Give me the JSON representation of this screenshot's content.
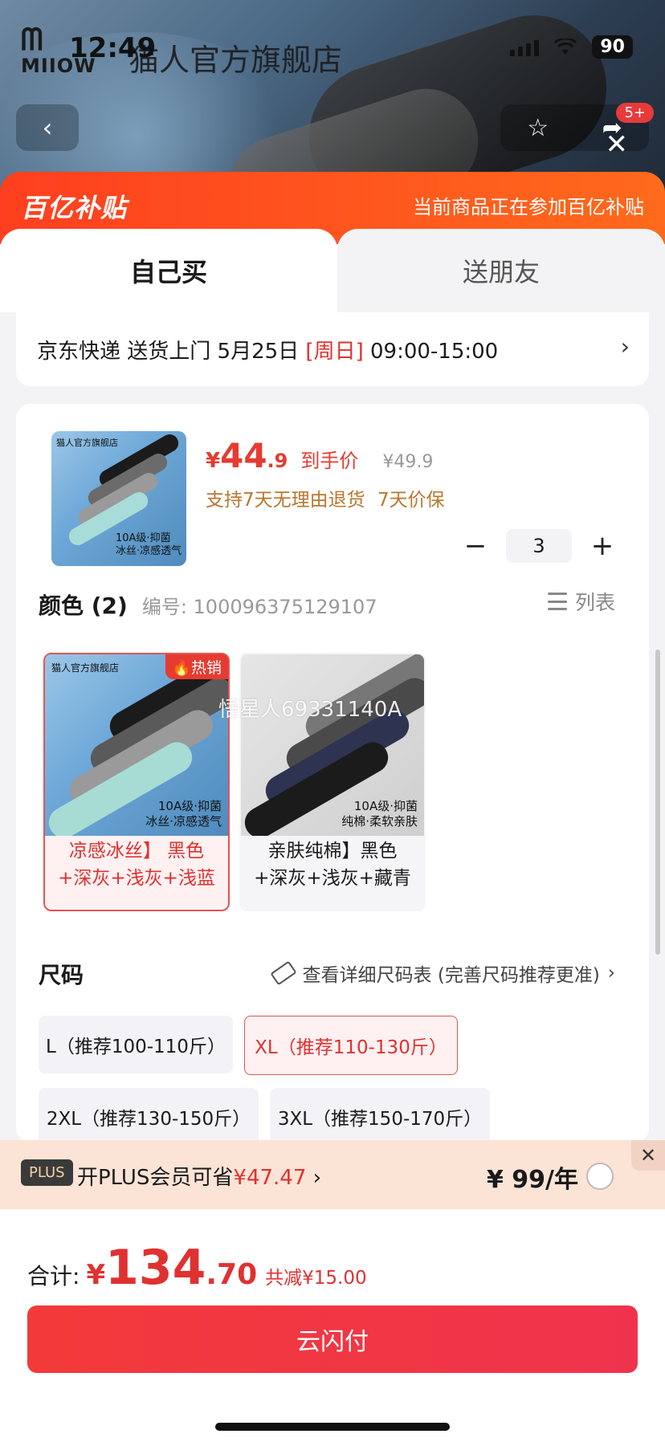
{
  "status_bar": {
    "time": "12:49",
    "battery": "90"
  },
  "header": {
    "brand_logo": "MIIOW",
    "store_name": "猫人官方旗舰店",
    "back_icon": "chevron-left-icon",
    "badge": "5+"
  },
  "subsidy": {
    "logo": "百亿补贴",
    "note": "当前商品正在参加百亿补贴"
  },
  "tabs": [
    {
      "label": "自己买"
    },
    {
      "label": "送朋友"
    }
  ],
  "delivery": {
    "prefix": "京东快递 送货上门 5月25日 ",
    "day": "[周日]",
    "time": " 09:00-15:00"
  },
  "product": {
    "thumb_brand": "猫人官方旗舰店",
    "thumb_caption_1": "10A级·抑菌",
    "thumb_caption_2": "冰丝·凉感透气",
    "price_currency": "¥",
    "price_int": "44",
    "price_dec": ".9",
    "price_label": "到手价",
    "price_original": "¥49.9",
    "service_tags": "支持7天无理由退货  7天价保",
    "quantity": "3",
    "qty_minus": "−",
    "qty_plus": "+"
  },
  "color_section": {
    "title": "颜色 (2)",
    "code": "编号: 100096375129107",
    "list_label": "列表",
    "watermark": "悟星人69331140A",
    "variants": [
      {
        "label_1": "凉感冰丝】 黑色",
        "label_2": "+深灰+浅灰+浅蓝",
        "caption_1": "10A级·抑菌",
        "caption_2": "冰丝·凉感透气",
        "brand": "猫人官方旗舰店",
        "hot": "热销",
        "selected": true
      },
      {
        "label_1": "亲肤纯棉】黑色",
        "label_2": "+深灰+浅灰+藏青",
        "caption_1": "10A级·抑菌",
        "caption_2": "纯棉·柔软亲肤",
        "selected": false
      }
    ]
  },
  "size_section": {
    "title": "尺码",
    "chart_link": "查看详细尺码表 (完善尺码推荐更准)",
    "sizes": [
      {
        "label": "L（推荐100-110斤）",
        "selected": false
      },
      {
        "label": "XL（推荐110-130斤）",
        "selected": true
      },
      {
        "label": "2XL（推荐130-150斤）",
        "selected": false
      },
      {
        "label": "3XL（推荐150-170斤）",
        "selected": false
      }
    ]
  },
  "plus": {
    "badge": "PLUS",
    "text_prefix": "开PLUS会员可省",
    "save_amount": "¥47.47",
    "price": "¥ 99/年"
  },
  "total": {
    "label": "合计:",
    "currency": "¥",
    "amount_int": "134",
    "amount_dec": ".70",
    "savings": "共减¥15.00"
  },
  "pay_button": "云闪付",
  "colors": {
    "accent": "#e63b30",
    "subsidy": "#ff4a1c",
    "pay": "#f23a3a"
  }
}
